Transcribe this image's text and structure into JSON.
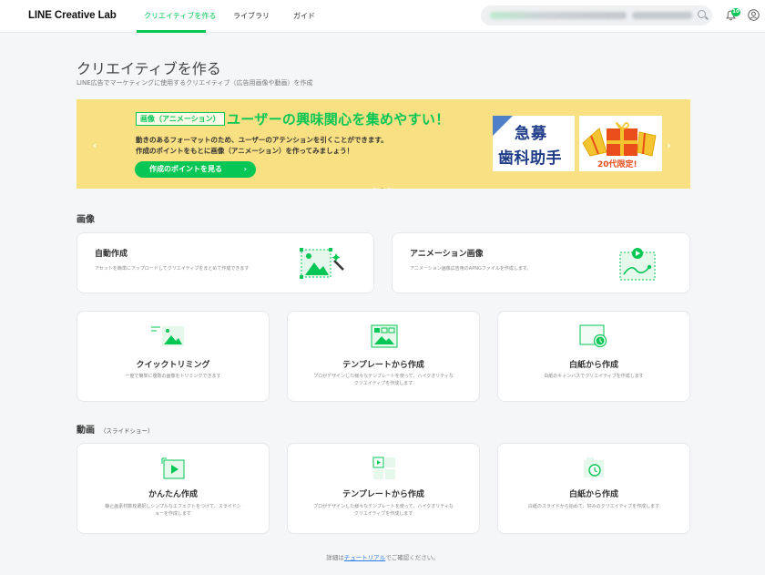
{
  "header": {
    "logo": "LINE Creative Lab",
    "nav": [
      {
        "label": "クリエイティブを作る",
        "active": true
      },
      {
        "label": "ライブラリ",
        "active": false
      },
      {
        "label": "ガイド",
        "active": false
      }
    ],
    "notification_count": "10",
    "icons": [
      "search-icon",
      "bell-icon",
      "user-icon"
    ]
  },
  "page": {
    "title": "クリエイティブを作る",
    "subtitle": "LINE広告でマーケティングに使用するクリエイティブ（広告用画像や動画）を作成"
  },
  "banner": {
    "tag": "画像（アニメーション）",
    "headline": "ユーザーの興味関心を集めやすい！",
    "line1": "動きのあるフォーマットのため、ユーザーのアテンションを引くことができます。",
    "line2": "作成のポイントをもとに画像（アニメーション）を作ってみましょう！",
    "cta": "作成のポイントを見る",
    "ad1_line1": "急募",
    "ad1_line2": "歯科助手",
    "ad2_text": "20代限定!",
    "prev": "‹",
    "next": "›"
  },
  "image_section": {
    "title": "画像",
    "cards": [
      {
        "title": "自動作成",
        "desc": "アセットを簡単にアップロードしてクリエイティブをまとめて作成できます",
        "icon": "auto-create-icon"
      },
      {
        "title": "アニメーション画像",
        "desc": "アニメーション画像広告用のAPNGファイルを作成します。",
        "icon": "animation-image-icon"
      },
      {
        "title": "クイックトリミング",
        "desc": "一度で簡単に複数の画像をトリミングできます",
        "icon": "quick-trim-icon"
      },
      {
        "title": "テンプレートから作成",
        "desc": "プロがデザインした様々なテンプレートを使って、ハイクオリティなクリエイティブを作成します",
        "icon": "template-icon"
      },
      {
        "title": "白紙から作成",
        "desc": "白紙のキャンバスでクリエイティブを作成します",
        "icon": "blank-canvas-icon"
      }
    ]
  },
  "video_section": {
    "title": "動画",
    "subtitle": "（スライドショー）",
    "cards": [
      {
        "title": "かんたん作成",
        "desc": "静止画素材数枚選択しシンプルなエフェクトをつけて、スライドショーを作成します",
        "icon": "easy-video-icon"
      },
      {
        "title": "テンプレートから作成",
        "desc": "プロがデザインした様々なテンプレートを使って、ハイクオリティなクリエイティブを作成します",
        "icon": "video-template-icon"
      },
      {
        "title": "白紙から作成",
        "desc": "白紙のスライドから始めて、好みのクリエイティブを作成します",
        "icon": "blank-video-icon"
      }
    ]
  },
  "footer": {
    "prefix": "詳細は",
    "link": "チュートリアル",
    "suffix": "でご確認ください。"
  },
  "colors": {
    "brand": "#06c755",
    "banner_bg": "#f9e082"
  }
}
